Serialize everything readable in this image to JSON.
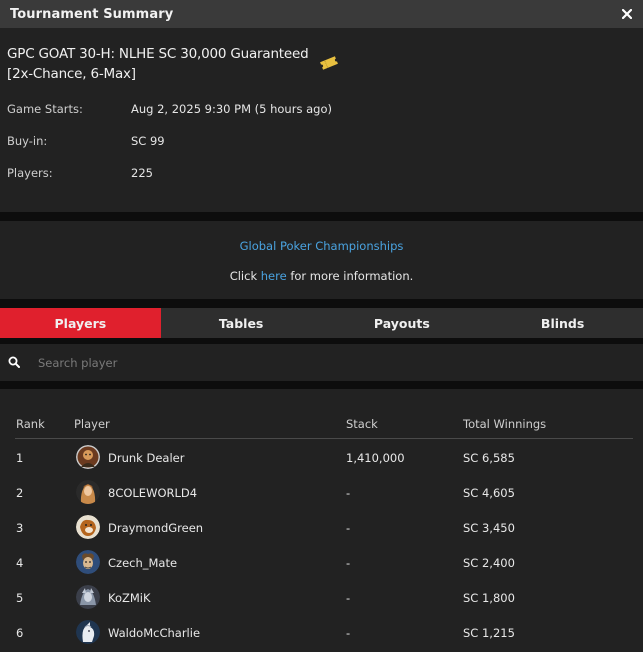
{
  "window": {
    "title": "Tournament Summary",
    "close_icon": "close-icon"
  },
  "tournament": {
    "name": "GPC GOAT 30-H: NLHE SC 30,000 Guaranteed [2x-Chance, 6-Max]",
    "ticket_icon": "ticket-icon",
    "game_starts_label": "Game Starts:",
    "game_starts_value": "Aug 2, 2025 9:30 PM (5 hours ago)",
    "buyin_label": "Buy-in:",
    "buyin_value": "SC 99",
    "players_label": "Players:",
    "players_value": "225"
  },
  "promo": {
    "link_title": "Global Poker Championships",
    "click_text": "Click ",
    "here_text": "here",
    "suffix_text": " for more information."
  },
  "tabs": [
    {
      "label": "Players",
      "active": true
    },
    {
      "label": "Tables",
      "active": false
    },
    {
      "label": "Payouts",
      "active": false
    },
    {
      "label": "Blinds",
      "active": false
    }
  ],
  "search": {
    "placeholder": "Search player",
    "icon": "search-icon"
  },
  "table": {
    "headers": {
      "rank": "Rank",
      "player": "Player",
      "stack": "Stack",
      "winnings": "Total Winnings"
    },
    "rows": [
      {
        "rank": "1",
        "player": "Drunk Dealer",
        "stack": "1,410,000",
        "winnings": "SC 6,585"
      },
      {
        "rank": "2",
        "player": "8COLEWORLD4",
        "stack": "-",
        "winnings": "SC 4,605"
      },
      {
        "rank": "3",
        "player": "DraymondGreen",
        "stack": "-",
        "winnings": "SC 3,450"
      },
      {
        "rank": "4",
        "player": "Czech_Mate",
        "stack": "-",
        "winnings": "SC 2,400"
      },
      {
        "rank": "5",
        "player": "KoZMiK",
        "stack": "-",
        "winnings": "SC 1,800"
      },
      {
        "rank": "6",
        "player": "WaldoMcCharlie",
        "stack": "-",
        "winnings": "SC 1,215"
      }
    ]
  },
  "colors": {
    "accent": "#e0202d",
    "link": "#4aa3e0",
    "panel": "#222222",
    "tabbar": "#2e2e2e"
  }
}
